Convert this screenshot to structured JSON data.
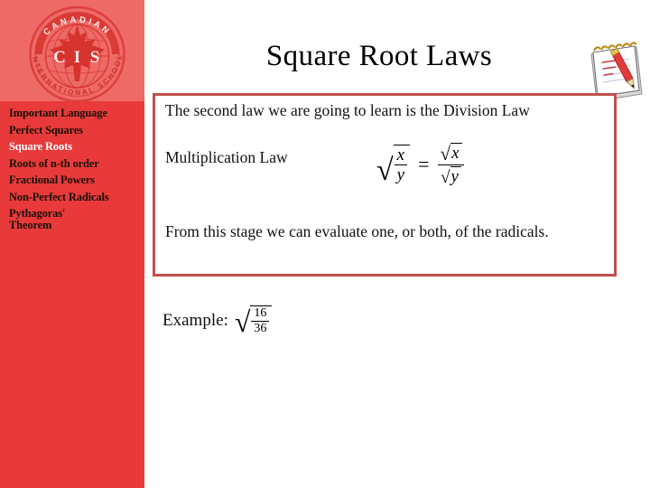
{
  "slide": {
    "title": "Square Root Laws",
    "background_color": "#ffffff"
  },
  "sidebar": {
    "background_color": "#e83a3a",
    "logo_band_color": "#ee6a66",
    "logo": {
      "name": "cis-school-logo",
      "center_text": "CIS",
      "arc_top_text": "CANADIAN",
      "arc_bottom_text": "INTERNATIONAL SCHOOL"
    },
    "items": [
      {
        "label": "Important Language",
        "active": false
      },
      {
        "label": "Perfect Squares",
        "active": false
      },
      {
        "label": "Square Roots",
        "active": true
      },
      {
        "label": "Roots of n-th order",
        "active": false
      },
      {
        "label": "Fractional Powers",
        "active": false
      },
      {
        "label": "Non-Perfect Radicals",
        "active": false
      },
      {
        "label": "Pythagoras'\nTheorem",
        "active": false
      }
    ]
  },
  "content_box": {
    "border_color": "#c0504d",
    "lead_line": "The second law we are going to learn is the Division Law",
    "law_label": "Multiplication Law",
    "closing_line": "From this stage we can evaluate one, or both, of the radicals.",
    "formula": {
      "description": "sqrt(x/y) = sqrt(x)/sqrt(y)",
      "lhs_numerator": "x",
      "lhs_denominator": "y",
      "operator": "=",
      "rhs_numerator": "x",
      "rhs_denominator": "y",
      "radical_symbol": "√"
    }
  },
  "example": {
    "label": "Example:",
    "radical_symbol": "√",
    "numerator": "16",
    "denominator": "36"
  },
  "decoration": {
    "notepad_icon_name": "notepad-with-pencil-icon"
  }
}
